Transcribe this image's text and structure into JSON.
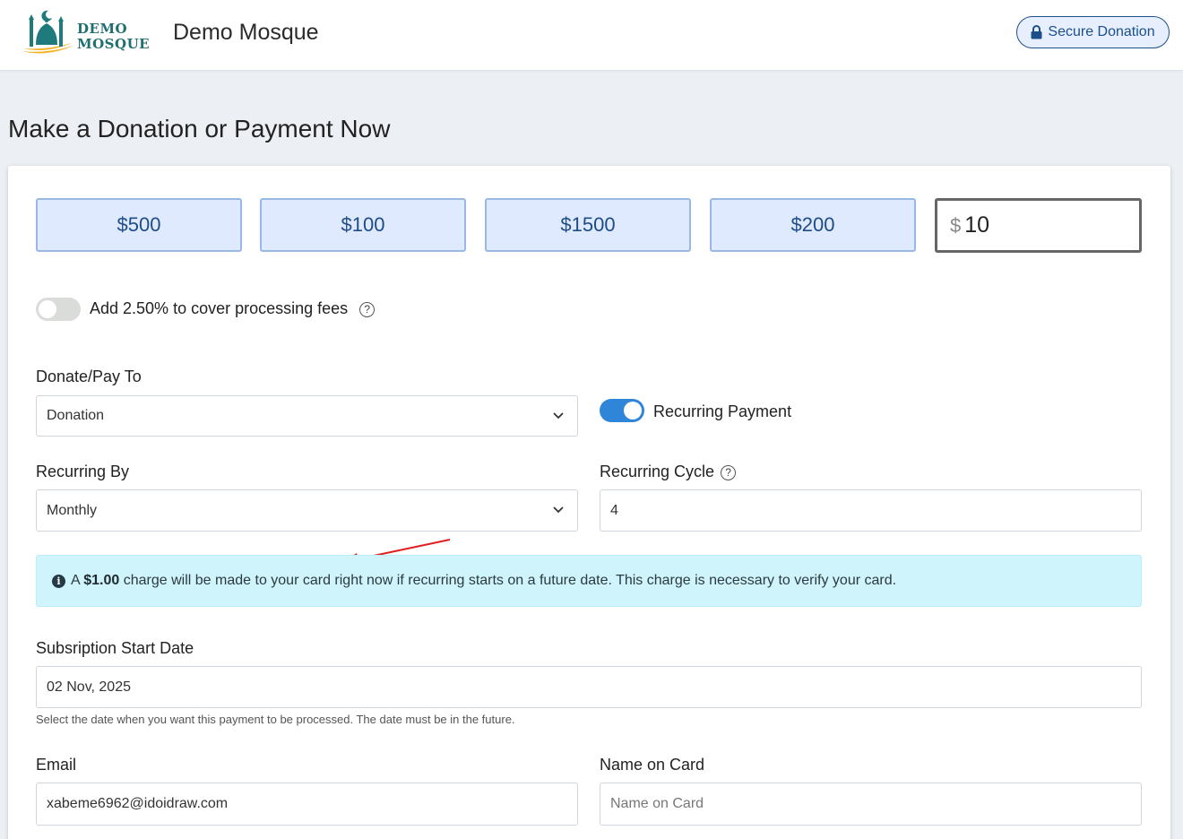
{
  "header": {
    "logo_line1": "DEMO",
    "logo_line2": "MOSQUE",
    "site_title": "Demo Mosque",
    "secure_label": "Secure Donation"
  },
  "page_title": "Make a Donation or Payment Now",
  "amounts": [
    "$500",
    "$100",
    "$1500",
    "$200"
  ],
  "custom_amount": {
    "currency": "$",
    "value": "10"
  },
  "fees": {
    "label": "Add 2.50% to cover processing fees",
    "enabled": false
  },
  "donate_to": {
    "label": "Donate/Pay To",
    "value": "Donation"
  },
  "recurring_payment": {
    "label": "Recurring Payment",
    "enabled": true
  },
  "recurring_by": {
    "label": "Recurring By",
    "value": "Monthly"
  },
  "recurring_cycle": {
    "label": "Recurring Cycle",
    "value": "4"
  },
  "alert": {
    "prefix": "A",
    "amount": "$1.00",
    "suffix": "charge will be made to your card right now if recurring starts on a future date. This charge is necessary to verify your card."
  },
  "start_date": {
    "label": "Subsription Start Date",
    "value": "02 Nov, 2025",
    "hint": "Select the date when you want this payment to be processed. The date must be in the future."
  },
  "email": {
    "label": "Email",
    "value": "xabeme6962@idoidraw.com"
  },
  "name_on_card": {
    "label": "Name on Card",
    "placeholder": "Name on Card"
  },
  "colors": {
    "accent": "#2f86d9",
    "button_bg": "#dfeafe",
    "button_text": "#1d4c86",
    "alert_bg": "#cff4fc",
    "arrow": "#e02020"
  },
  "icons": {
    "secure": "lock-icon",
    "help": "question-circle-icon",
    "alert": "info-circle-icon",
    "select": "chevron-down-icon"
  }
}
